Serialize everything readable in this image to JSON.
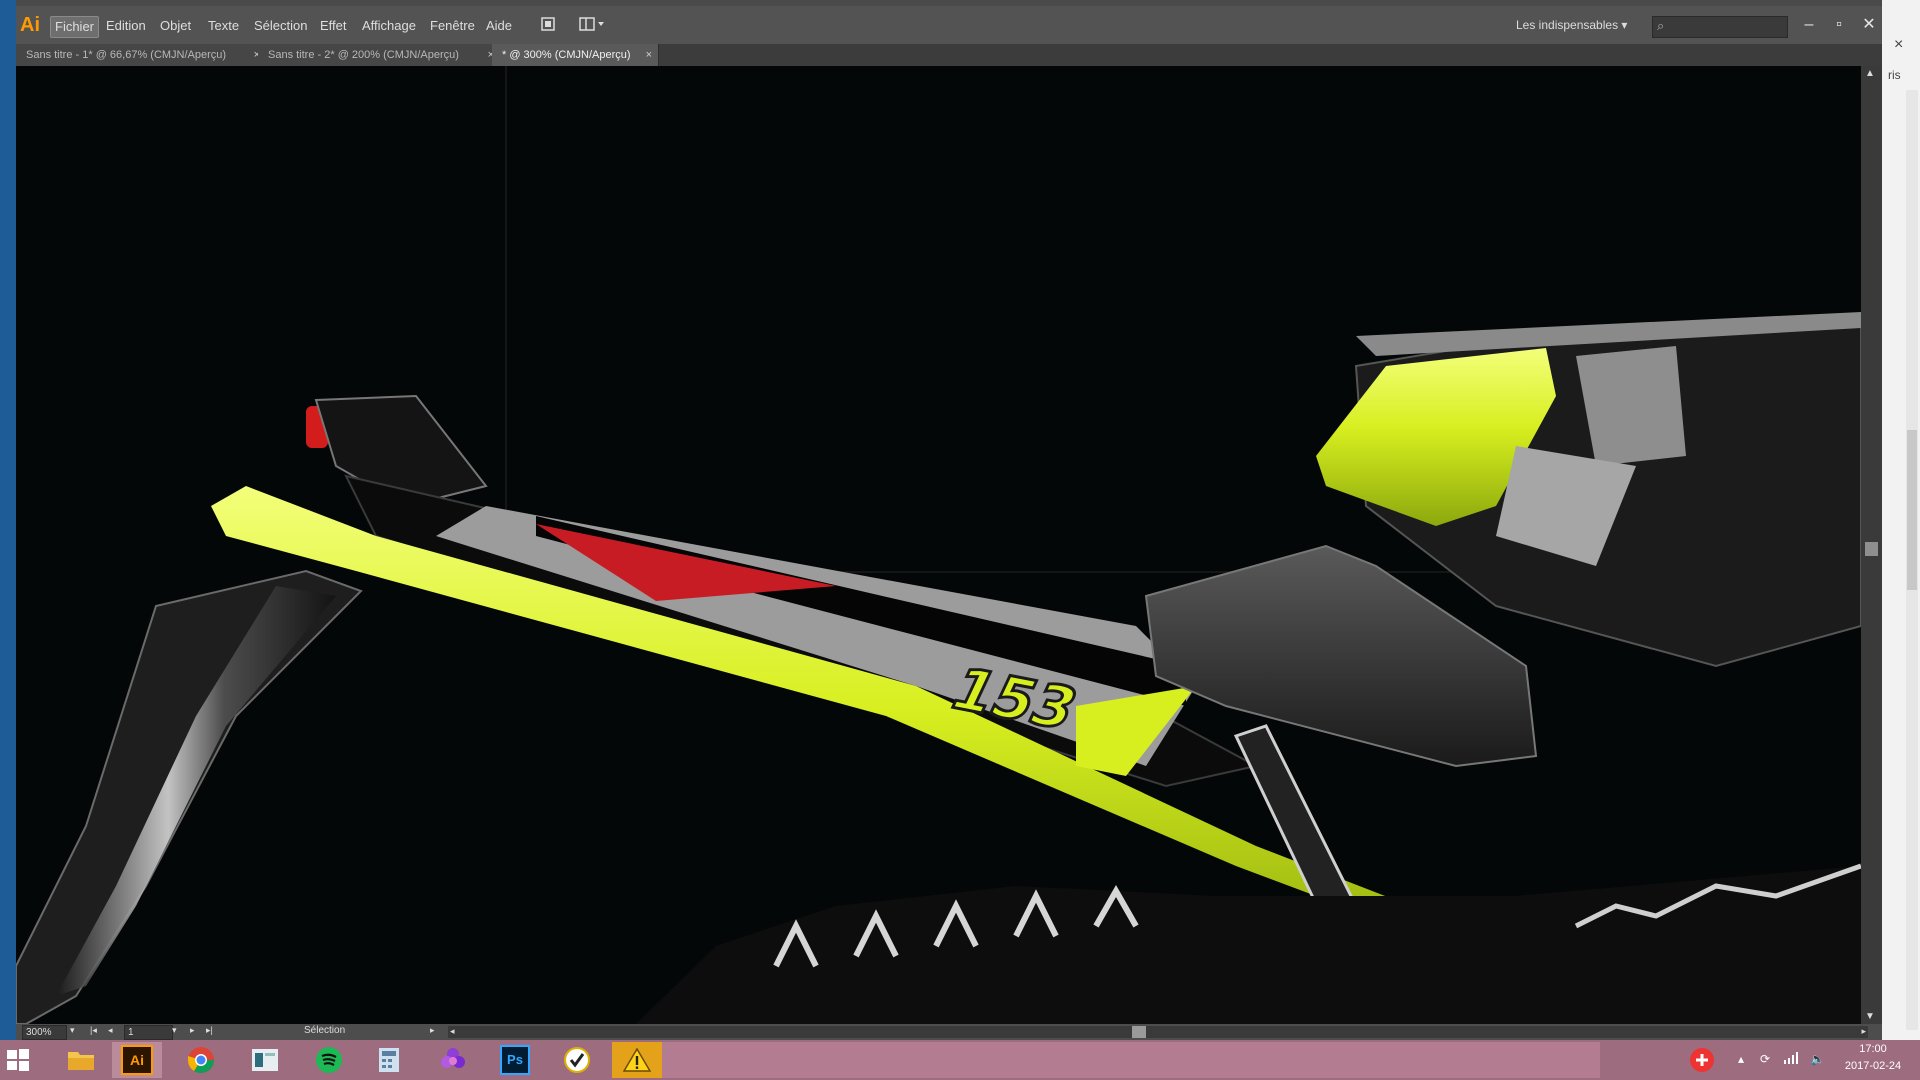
{
  "app": {
    "logo": "Ai",
    "menu": [
      "Fichier",
      "Edition",
      "Objet",
      "Texte",
      "Sélection",
      "Effet",
      "Affichage",
      "Fenêtre",
      "Aide"
    ],
    "workspace": "Les indispensables",
    "window_controls": [
      "minimize",
      "maximize",
      "close"
    ]
  },
  "tabs": [
    {
      "label": "Sans titre - 1* @ 66,67% (CMJN/Aperçu)",
      "close": "×"
    },
    {
      "label": "Sans titre - 2* @ 200% (CMJN/Aperçu)",
      "close": "×"
    },
    {
      "label": "* @ 300% (CMJN/Aperçu)",
      "close": "×"
    }
  ],
  "artwork": {
    "description_icon": "snowmobile-photo",
    "decal_number": "153",
    "colors": {
      "lime": "#d7ef1f",
      "red": "#c81c24",
      "background": "#040708",
      "grey": "#9c9c9c"
    }
  },
  "status": {
    "zoom": "300%",
    "artboard": "1",
    "tool": "Sélection"
  },
  "desktop_right": {
    "close": "×",
    "partial_text": "ris"
  },
  "taskbar": {
    "apps": [
      "file-explorer-icon",
      "illustrator-icon",
      "chrome-icon",
      "window-icon",
      "spotify-icon",
      "calculator-icon",
      "flower-icon",
      "photoshop-icon",
      "checkmark-app-icon",
      "warning-icon"
    ],
    "illustrator_label": "Ai",
    "photoshop_label": "Ps",
    "time": "17:00",
    "date": "2017-02-24"
  }
}
